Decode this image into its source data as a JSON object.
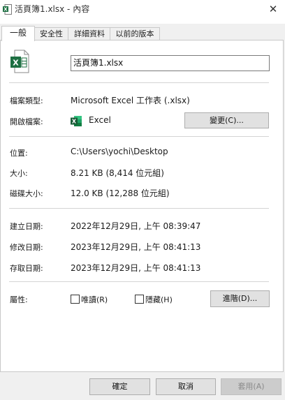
{
  "window": {
    "title": "活頁簿1.xlsx - 內容",
    "close_symbol": "✕"
  },
  "tabs": [
    "一般",
    "安全性",
    "詳細資料",
    "以前的版本"
  ],
  "file": {
    "name": "活頁簿1.xlsx",
    "type_label": "檔案類型:",
    "type_value": "Microsoft Excel 工作表 (.xlsx)",
    "opens_with_label": "開啟檔案:",
    "opens_with_value": "Excel",
    "change_button": "變更(C)..."
  },
  "location": {
    "label": "位置:",
    "value": "C:\\Users\\yochi\\Desktop"
  },
  "size": {
    "label": "大小:",
    "value": "8.21 KB (8,414 位元組)"
  },
  "size_on_disk": {
    "label": "磁碟大小:",
    "value": "12.0 KB (12,288 位元組)"
  },
  "dates": {
    "created_label": "建立日期:",
    "created_value": "2022年12月29日, 上午 08:39:47",
    "modified_label": "修改日期:",
    "modified_value": "2023年12月29日, 上午 08:41:13",
    "accessed_label": "存取日期:",
    "accessed_value": "2023年12月29日, 上午 08:41:13"
  },
  "attributes": {
    "label": "屬性:",
    "readonly": "唯讀(R)",
    "hidden": "隱藏(H)",
    "advanced_button": "進階(D)..."
  },
  "footer": {
    "ok": "確定",
    "cancel": "取消",
    "apply": "套用(A)"
  },
  "colors": {
    "excel_green": "#1d6f42",
    "disabled_text": "#8a8a8a"
  }
}
